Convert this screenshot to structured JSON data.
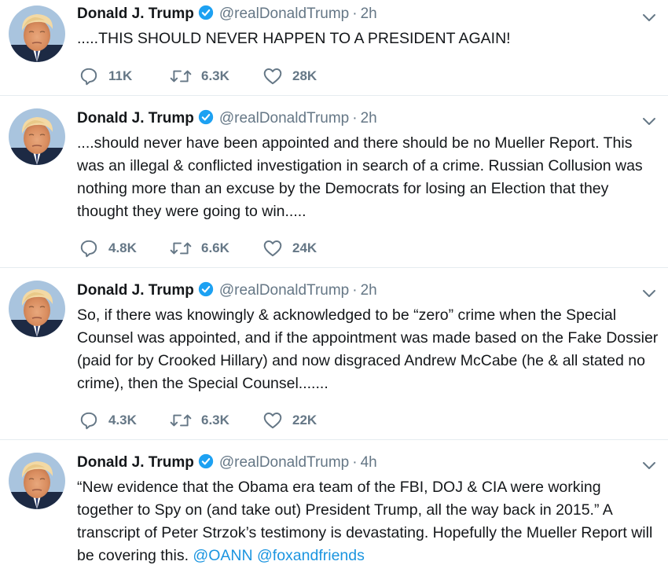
{
  "author": {
    "name": "Donald J. Trump",
    "handle": "@realDonaldTrump",
    "verified": true
  },
  "colors": {
    "link": "#1b95e0",
    "verified": "#1da1f2",
    "meta": "#657786",
    "divider": "#e6ecf0"
  },
  "icons": {
    "reply": "reply-icon",
    "retweet": "retweet-icon",
    "like": "like-icon",
    "menu": "chevron-down-icon",
    "verified": "verified-badge-icon"
  },
  "tweets": [
    {
      "time": "2h",
      "text": ".....THIS SHOULD NEVER HAPPEN TO A PRESIDENT AGAIN!",
      "replies": "11K",
      "retweets": "6.3K",
      "likes": "28K"
    },
    {
      "time": "2h",
      "text": "....should never have been appointed and there should be no Mueller Report. This was an illegal & conflicted investigation in search of a crime. Russian Collusion was nothing more than an excuse by the Democrats for losing an Election that they thought they were going to win.....",
      "replies": "4.8K",
      "retweets": "6.6K",
      "likes": "24K"
    },
    {
      "time": "2h",
      "text": "So, if there was knowingly & acknowledged to be “zero” crime when the Special Counsel was appointed, and if the appointment was made based on the Fake Dossier (paid for by Crooked Hillary) and now disgraced Andrew McCabe (he & all stated no crime), then the Special Counsel.......",
      "replies": "4.3K",
      "retweets": "6.3K",
      "likes": "22K"
    },
    {
      "time": "4h",
      "text": "“New evidence that the Obama era team of the FBI, DOJ & CIA were working together to Spy on (and take out) President Trump, all the way back in 2015.” A transcript of Peter Strzok’s testimony is devastating. Hopefully the Mueller Report will be covering this.",
      "mentions": [
        "@OANN",
        "@foxandfriends"
      ]
    }
  ]
}
